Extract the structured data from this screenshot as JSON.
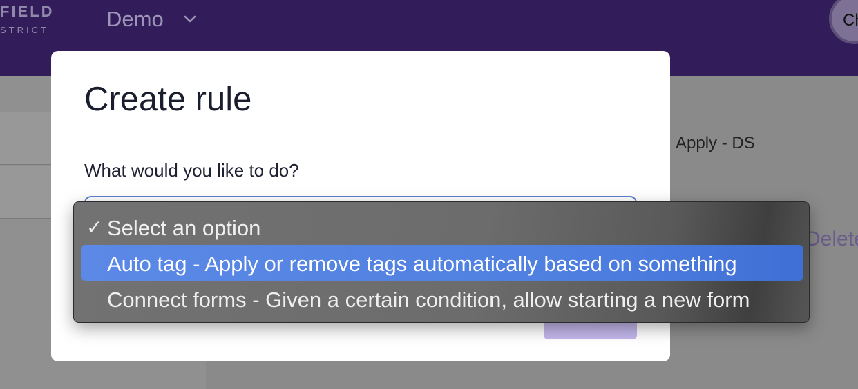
{
  "app": {
    "logo_line1": "FIELD",
    "logo_line2": "STRICT",
    "workspace": "Demo",
    "avatar_initials": "Ch"
  },
  "background": {
    "apply_text": "Apply - DS",
    "delete_text": "Delete"
  },
  "modal": {
    "title": "Create rule",
    "field_label": "What would you like to do?"
  },
  "dropdown": {
    "selected_index": 0,
    "highlighted_index": 1,
    "options": [
      {
        "label": "Select an option",
        "checked": true
      },
      {
        "label": "Auto tag - Apply or remove tags automatically based on something",
        "checked": false
      },
      {
        "label": "Connect forms - Given a certain condition, allow starting a new form",
        "checked": false
      }
    ]
  },
  "colors": {
    "topbar": "#331c5a",
    "highlight": "#4e7fe0",
    "focus_ring": "#5b7fd1",
    "submit_button": "#c3b7eb"
  }
}
